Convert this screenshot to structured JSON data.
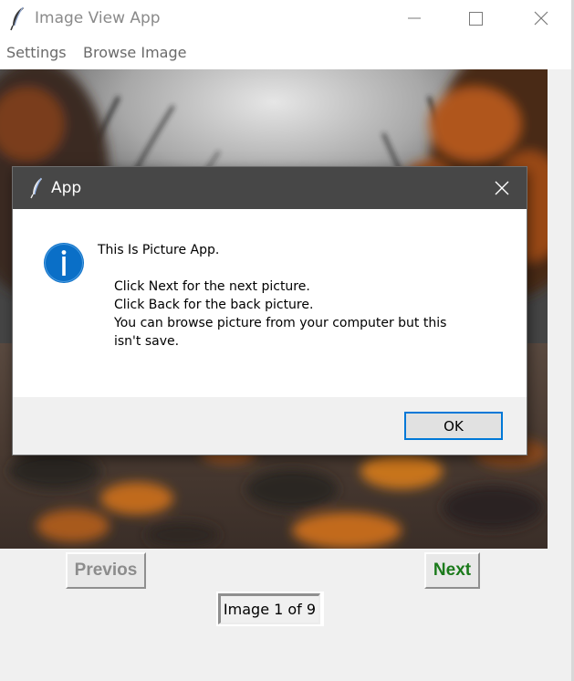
{
  "window": {
    "title": "Image View App",
    "icon": "feather-icon",
    "controls": [
      "minimize-icon",
      "maximize-icon",
      "close-icon"
    ]
  },
  "menu": {
    "items": [
      "Settings",
      "Browse Image"
    ]
  },
  "image_area": {
    "icon": "photo-autumn-forest-path"
  },
  "nav": {
    "prev_label": "Previos",
    "next_label": "Next",
    "counter": "Image 1 of 9"
  },
  "dialog": {
    "title": "App",
    "icon": "info-icon",
    "lines": [
      "This Is Picture App.",
      "Click Next for the next picture.",
      "Click Back for the back picture.",
      "You can browse picture from your computer but this",
      "isn't save."
    ],
    "ok_label": "OK"
  },
  "colors": {
    "next_text": "#1b7a1b",
    "prev_text": "#8c8c8c",
    "dialog_titlebar": "#474747",
    "ok_border": "#0078d7",
    "info_blue": "#0a6fc7"
  }
}
